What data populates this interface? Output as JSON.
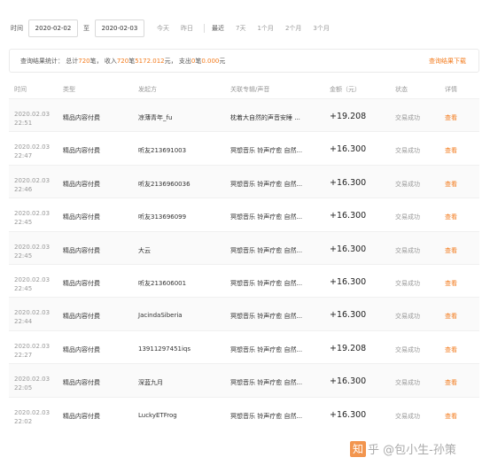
{
  "filter": {
    "time_label": "时间",
    "start_date": "2020-02-02",
    "to_label": "至",
    "end_date": "2020-02-03",
    "quick_today": "今天",
    "quick_yesterday": "昨日",
    "recent_label": "最近",
    "quick_7d": "7天",
    "quick_1m": "1个月",
    "quick_2m": "2个月",
    "quick_3m": "3个月"
  },
  "summary": {
    "prefix": "查询结果统计：  总计",
    "total_count": "720",
    "bi1": " 笔，  收入",
    "income_count": "720",
    "bi2": " 笔 ",
    "income_amount": "5172.012",
    "yuan1": " 元，  支出",
    "expense_count": "0",
    "bi3": " 笔",
    "expense_amount": "0.000",
    "yuan2": " 元",
    "export_label": "查询结果下载"
  },
  "table": {
    "headers": {
      "time": "时间",
      "type": "类型",
      "sender": "发起方",
      "album": "关联专辑/声音",
      "amount": "金额（元）",
      "status": "状态",
      "detail": "详情"
    },
    "rows": [
      {
        "date": "2020.02.03",
        "time": "22:51",
        "type": "精品内容付费",
        "sender": "凉薄青年_fu",
        "album": "枕着大自然的声音安睡 ...",
        "amount": "+19.208",
        "status": "交易成功",
        "detail": "查看"
      },
      {
        "date": "2020.02.03",
        "time": "22:47",
        "type": "精品内容付费",
        "sender": "听友213691003",
        "album": "冥想音乐 铃声疗愈 自然...",
        "amount": "+16.300",
        "status": "交易成功",
        "detail": "查看"
      },
      {
        "date": "2020.02.03",
        "time": "22:46",
        "type": "精品内容付费",
        "sender": "听友2136960036",
        "album": "冥想音乐 铃声疗愈 自然...",
        "amount": "+16.300",
        "status": "交易成功",
        "detail": "查看"
      },
      {
        "date": "2020.02.03",
        "time": "22:45",
        "type": "精品内容付费",
        "sender": "听友313696099",
        "album": "冥想音乐 铃声疗愈 自然...",
        "amount": "+16.300",
        "status": "交易成功",
        "detail": "查看"
      },
      {
        "date": "2020.02.03",
        "time": "22:45",
        "type": "精品内容付费",
        "sender": "大云",
        "album": "冥想音乐 铃声疗愈 自然...",
        "amount": "+16.300",
        "status": "交易成功",
        "detail": "查看"
      },
      {
        "date": "2020.02.03",
        "time": "22:45",
        "type": "精品内容付费",
        "sender": "听友213606001",
        "album": "冥想音乐 铃声疗愈 自然...",
        "amount": "+16.300",
        "status": "交易成功",
        "detail": "查看"
      },
      {
        "date": "2020.02.03",
        "time": "22:44",
        "type": "精品内容付费",
        "sender": "JacindaSiberia",
        "album": "冥想音乐 铃声疗愈 自然...",
        "amount": "+16.300",
        "status": "交易成功",
        "detail": "查看"
      },
      {
        "date": "2020.02.03",
        "time": "22:27",
        "type": "精品内容付费",
        "sender": "13911297451iqs",
        "album": "冥想音乐 铃声疗愈 自然...",
        "amount": "+19.208",
        "status": "交易成功",
        "detail": "查看"
      },
      {
        "date": "2020.02.03",
        "time": "22:05",
        "type": "精品内容付费",
        "sender": "深蓝九月",
        "album": "冥想音乐 铃声疗愈 自然...",
        "amount": "+16.300",
        "status": "交易成功",
        "detail": "查看"
      },
      {
        "date": "2020.02.03",
        "time": "22:02",
        "type": "精品内容付费",
        "sender": "LuckyETFrog",
        "album": "冥想音乐 铃声疗愈 自然...",
        "amount": "+16.300",
        "status": "交易成功",
        "detail": "查看"
      }
    ]
  },
  "watermark": {
    "logo_char": "知",
    "text": "乎 @包小生-孙策"
  },
  "colors": {
    "accent": "#f37b1d"
  }
}
